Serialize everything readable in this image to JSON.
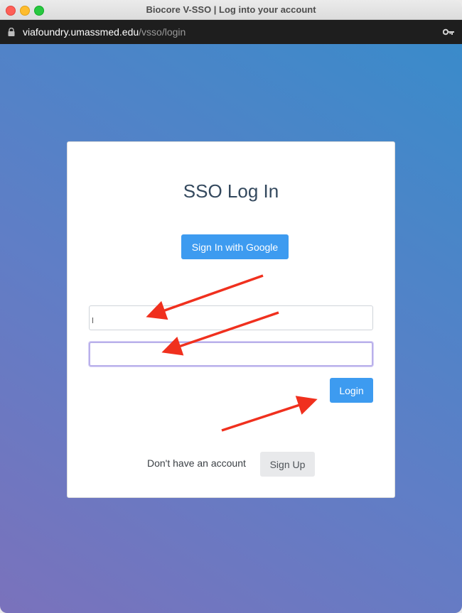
{
  "window": {
    "title": "Biocore V-SSO | Log into your account"
  },
  "address_bar": {
    "host": "viafoundry.umassmed.edu",
    "path": "/vsso/login",
    "icons": [
      "lock-icon",
      "key-icon"
    ]
  },
  "login_card": {
    "title": "SSO Log In",
    "google_button_label": "Sign In with Google",
    "username_value": "",
    "password_value": "",
    "login_button_label": "Login",
    "no_account_text": "Don't have an account",
    "signup_button_label": "Sign Up"
  },
  "colors": {
    "primary_button": "#3d9bf0",
    "annotation_arrow": "#f0301e",
    "focused_border": "#b9b0ea"
  }
}
